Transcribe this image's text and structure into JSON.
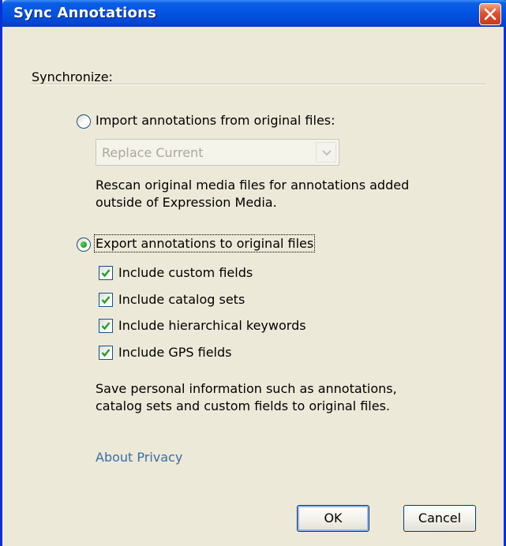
{
  "window": {
    "title": "Sync Annotations"
  },
  "section": {
    "label": "Synchronize:"
  },
  "import_option": {
    "label": "Import annotations from original files:",
    "selected": false,
    "dropdown": {
      "value": "Replace Current",
      "disabled": true
    },
    "description": [
      "Rescan original media files for annotations added",
      "outside of Expression Media."
    ]
  },
  "export_option": {
    "label": "Export annotations to original files",
    "selected": true,
    "checkboxes": [
      {
        "label": "Include custom fields",
        "checked": true
      },
      {
        "label": "Include catalog sets",
        "checked": true
      },
      {
        "label": "Include hierarchical keywords",
        "checked": true
      },
      {
        "label": "Include GPS fields",
        "checked": true
      }
    ],
    "description": [
      "Save personal information such as annotations,",
      "catalog sets and custom fields to original files."
    ]
  },
  "privacy_link": "About Privacy",
  "buttons": {
    "ok": "OK",
    "cancel": "Cancel"
  },
  "colors": {
    "title_bar": "#0354e3",
    "dialog_bg": "#ece9d8",
    "link": "#3a6ea5",
    "close_button": "#e0532b",
    "radio_dot": "#21a121",
    "checkmark": "#21a121"
  }
}
